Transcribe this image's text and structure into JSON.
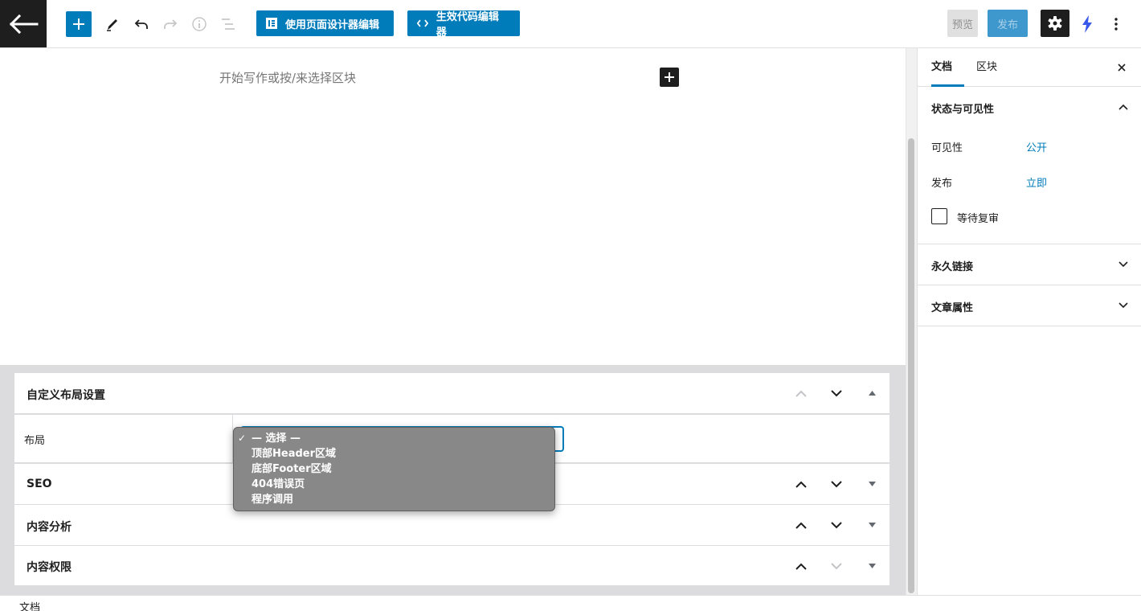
{
  "toolbar": {
    "designer_btn": "使用页面设计器编辑",
    "code_btn": "生效代码编辑器",
    "preview": "预览",
    "publish": "发布"
  },
  "editor": {
    "placeholder": "开始写作或按/来选择区块"
  },
  "meta_boxes": {
    "layout_panel_title": "自定义布局设置",
    "layout_label": "布局",
    "layout_options": [
      "— 选择 —",
      "顶部Header区域",
      "底部Footer区域",
      "404错误页",
      "程序调用"
    ],
    "selected_option": "— 选择 —",
    "seo_title": "SEO",
    "analysis_title": "内容分析",
    "permission_title": "内容权限"
  },
  "status_bar": {
    "breadcrumb": "文档"
  },
  "sidebar": {
    "tab_document": "文档",
    "tab_block": "区块",
    "status_section": "状态与可见性",
    "visibility_label": "可见性",
    "visibility_value": "公开",
    "publish_label": "发布",
    "publish_value": "立即",
    "pending_review": "等待复审",
    "permalink_section": "永久链接",
    "page_attributes_section": "文章属性"
  },
  "colors": {
    "accent": "#007cba",
    "dark": "#1e1e1e",
    "metabox_bg": "#dcdcde",
    "dropdown_bg": "#888888",
    "bolt": "#3858e9"
  }
}
